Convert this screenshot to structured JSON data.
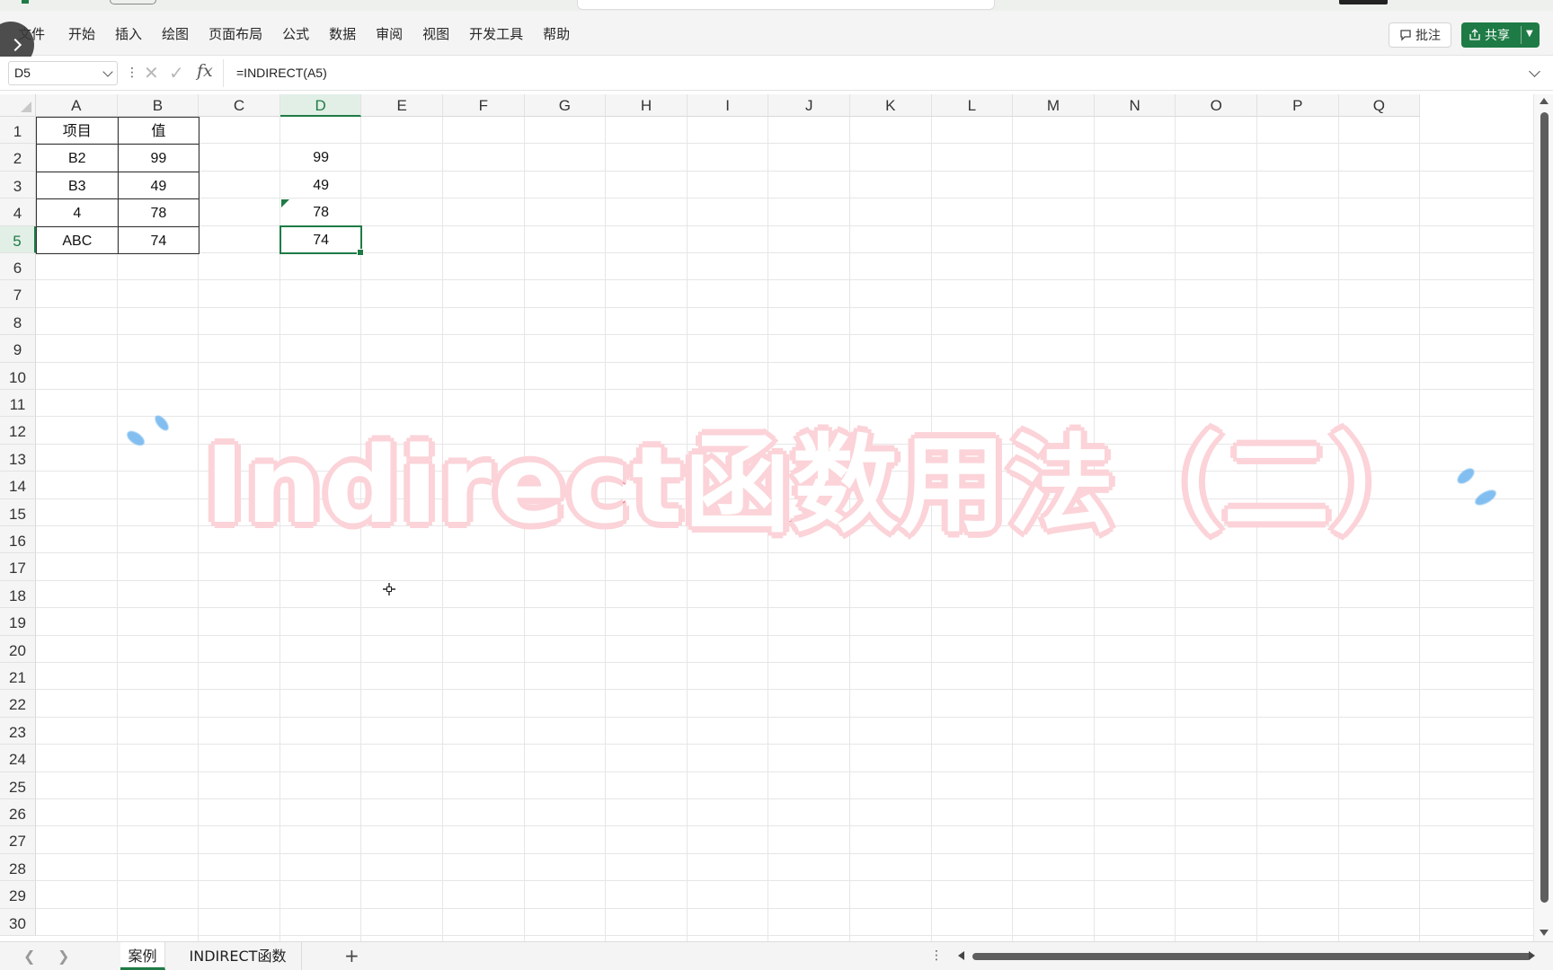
{
  "ribbon": {
    "menu": [
      "文件",
      "开始",
      "插入",
      "绘图",
      "页面布局",
      "公式",
      "数据",
      "审阅",
      "视图",
      "开发工具",
      "帮助"
    ],
    "comment_label": "批注",
    "share_label": "共享"
  },
  "formula_bar": {
    "name_box": "D5",
    "formula": "=INDIRECT(A5)",
    "fx_label": "fx"
  },
  "sheet": {
    "columns": [
      "A",
      "B",
      "C",
      "D",
      "E",
      "F",
      "G",
      "H",
      "I",
      "J",
      "K",
      "L",
      "M",
      "N",
      "O",
      "P",
      "Q"
    ],
    "rows": [
      "1",
      "2",
      "3",
      "4",
      "5",
      "6",
      "7",
      "8",
      "9",
      "10",
      "11",
      "12",
      "13",
      "14",
      "15",
      "16",
      "17",
      "18",
      "19",
      "20",
      "21",
      "22",
      "23",
      "24",
      "25",
      "26",
      "27",
      "28",
      "29",
      "30"
    ],
    "selected_column": "D",
    "selected_row": "5",
    "table": {
      "header": [
        "项目",
        "值"
      ],
      "rows": [
        [
          "B2",
          "99"
        ],
        [
          "B3",
          "49"
        ],
        [
          "4",
          "78"
        ],
        [
          "ABC",
          "74"
        ]
      ]
    },
    "column_d": [
      "99",
      "49",
      "78",
      "74"
    ]
  },
  "overlay": {
    "title": "Indirect函数用法（二）"
  },
  "tabs": {
    "sheets": [
      "案例",
      "INDIRECT函数"
    ],
    "active": "案例",
    "add_label": "+"
  },
  "colors": {
    "accent": "#1e7b45",
    "overlay_stroke": "#e8798a",
    "overlay_glow": "#fbd3d8",
    "sparkle": "#6db4ee"
  },
  "icons": [
    "sidebar-toggle-icon",
    "comment-icon",
    "share-icon",
    "dropdown-icon",
    "cancel-icon",
    "confirm-icon",
    "function-icon",
    "expand-icon",
    "move-cursor-icon"
  ]
}
